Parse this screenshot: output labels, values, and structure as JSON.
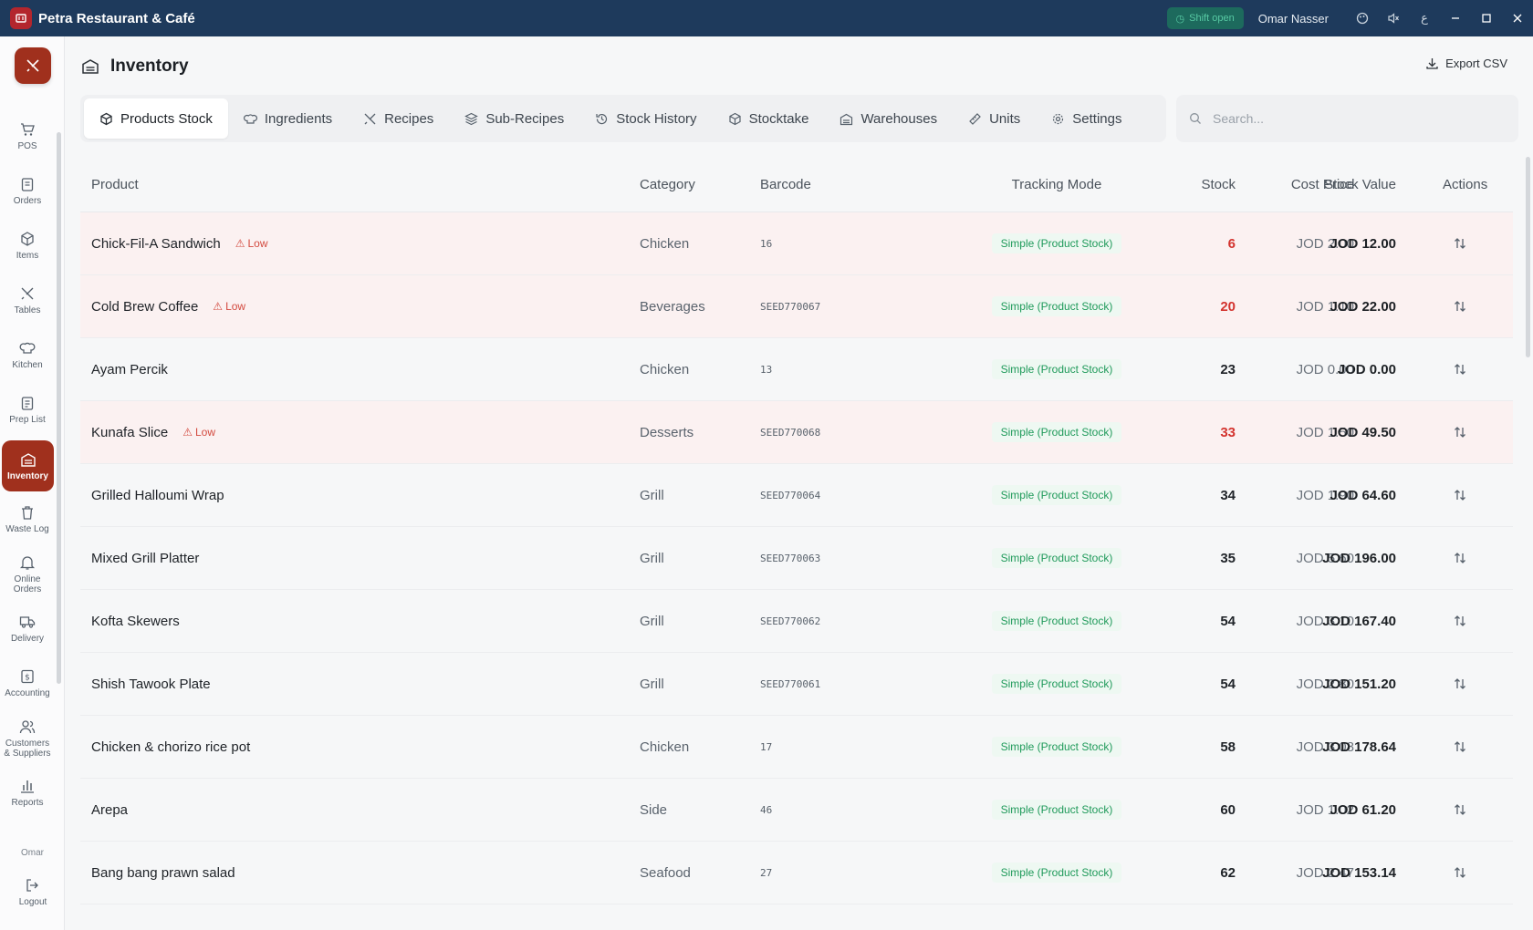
{
  "window": {
    "title": "Petra Restaurant & Café",
    "shift_status": "Shift open",
    "user": "Omar Nasser"
  },
  "sidebar": {
    "items": [
      {
        "label": "POS",
        "icon": "cart-icon"
      },
      {
        "label": "Orders",
        "icon": "clipboard-icon"
      },
      {
        "label": "Items",
        "icon": "box-icon"
      },
      {
        "label": "Tables",
        "icon": "utensils-icon"
      },
      {
        "label": "Kitchen",
        "icon": "chef-hat-icon"
      },
      {
        "label": "Prep List",
        "icon": "checklist-icon"
      },
      {
        "label": "Inventory",
        "icon": "warehouse-icon",
        "active": true
      },
      {
        "label": "Waste Log",
        "icon": "trash-icon"
      },
      {
        "label": "Online Orders",
        "icon": "bell-icon"
      },
      {
        "label": "Delivery",
        "icon": "truck-icon"
      },
      {
        "label": "Accounting",
        "icon": "dollar-icon"
      },
      {
        "label": "Customers & Suppliers",
        "icon": "users-icon"
      },
      {
        "label": "Reports",
        "icon": "bar-chart-icon"
      }
    ],
    "user_short": "Omar",
    "logout": "Logout"
  },
  "page": {
    "title": "Inventory",
    "export_label": "Export CSV"
  },
  "tabs": [
    {
      "label": "Products Stock",
      "active": true
    },
    {
      "label": "Ingredients"
    },
    {
      "label": "Recipes"
    },
    {
      "label": "Sub-Recipes"
    },
    {
      "label": "Stock History"
    },
    {
      "label": "Stocktake"
    },
    {
      "label": "Warehouses"
    },
    {
      "label": "Units"
    },
    {
      "label": "Settings"
    }
  ],
  "search": {
    "placeholder": "Search..."
  },
  "table": {
    "columns": [
      "Product",
      "Category",
      "Barcode",
      "Tracking Mode",
      "Stock",
      "Cost Price",
      "Stock Value",
      "Actions"
    ],
    "low_label": "Low",
    "rows": [
      {
        "product": "Chick-Fil-A Sandwich",
        "low": true,
        "category": "Chicken",
        "barcode": "16",
        "tracking": "Simple (Product Stock)",
        "stock": "6",
        "cost": "JOD 2.00",
        "value": "JOD 12.00"
      },
      {
        "product": "Cold Brew Coffee",
        "low": true,
        "category": "Beverages",
        "barcode": "SEED770067",
        "tracking": "Simple (Product Stock)",
        "stock": "20",
        "cost": "JOD 1.10",
        "value": "JOD 22.00"
      },
      {
        "product": "Ayam Percik",
        "low": false,
        "category": "Chicken",
        "barcode": "13",
        "tracking": "Simple (Product Stock)",
        "stock": "23",
        "cost": "JOD 0.00",
        "value": "JOD 0.00"
      },
      {
        "product": "Kunafa Slice",
        "low": true,
        "category": "Desserts",
        "barcode": "SEED770068",
        "tracking": "Simple (Product Stock)",
        "stock": "33",
        "cost": "JOD 1.50",
        "value": "JOD 49.50"
      },
      {
        "product": "Grilled Halloumi Wrap",
        "low": false,
        "category": "Grill",
        "barcode": "SEED770064",
        "tracking": "Simple (Product Stock)",
        "stock": "34",
        "cost": "JOD 1.90",
        "value": "JOD 64.60"
      },
      {
        "product": "Mixed Grill Platter",
        "low": false,
        "category": "Grill",
        "barcode": "SEED770063",
        "tracking": "Simple (Product Stock)",
        "stock": "35",
        "cost": "JOD 5.60",
        "value": "JOD 196.00"
      },
      {
        "product": "Kofta Skewers",
        "low": false,
        "category": "Grill",
        "barcode": "SEED770062",
        "tracking": "Simple (Product Stock)",
        "stock": "54",
        "cost": "JOD 3.10",
        "value": "JOD 167.40"
      },
      {
        "product": "Shish Tawook Plate",
        "low": false,
        "category": "Grill",
        "barcode": "SEED770061",
        "tracking": "Simple (Product Stock)",
        "stock": "54",
        "cost": "JOD 2.80",
        "value": "JOD 151.20"
      },
      {
        "product": "Chicken & chorizo rice pot",
        "low": false,
        "category": "Chicken",
        "barcode": "17",
        "tracking": "Simple (Product Stock)",
        "stock": "58",
        "cost": "JOD 3.08",
        "value": "JOD 178.64"
      },
      {
        "product": "Arepa",
        "low": false,
        "category": "Side",
        "barcode": "46",
        "tracking": "Simple (Product Stock)",
        "stock": "60",
        "cost": "JOD 1.02",
        "value": "JOD 61.20"
      },
      {
        "product": "Bang bang prawn salad",
        "low": false,
        "category": "Seafood",
        "barcode": "27",
        "tracking": "Simple (Product Stock)",
        "stock": "62",
        "cost": "JOD 2.47",
        "value": "JOD 153.14"
      }
    ]
  }
}
